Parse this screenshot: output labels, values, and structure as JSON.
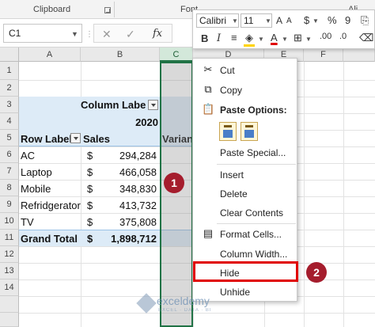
{
  "ribbon": {
    "clipboard_label": "Clipboard",
    "font_label": "Font",
    "alignment_label": "Ali"
  },
  "formula_bar": {
    "name_box": "C1",
    "cancel_glyph": "✕",
    "enter_glyph": "✓",
    "fx_label": "fx"
  },
  "columns": [
    "A",
    "B",
    "C",
    "D",
    "E",
    "F"
  ],
  "rows": [
    "1",
    "2",
    "3",
    "4",
    "5",
    "6",
    "7",
    "8",
    "9",
    "10",
    "11",
    "12",
    "13",
    "14"
  ],
  "pivot": {
    "column_labels": "Column Labels",
    "year": "2020",
    "row_labels": "Row Labels",
    "sales_header": "Sales",
    "variance_header": "Varian",
    "currency": "$",
    "items": [
      {
        "label": "AC",
        "value": "294,284"
      },
      {
        "label": "Laptop",
        "value": "466,058"
      },
      {
        "label": "Mobile",
        "value": "348,830"
      },
      {
        "label": "Refridgerator",
        "value": "413,732"
      },
      {
        "label": "TV",
        "value": "375,808"
      }
    ],
    "grand_total_label": "Grand Total",
    "grand_total_value": "1,898,712"
  },
  "mini_toolbar": {
    "font_name": "Calibri",
    "font_size": "11",
    "bold_glyph": "B",
    "italic_glyph": "I",
    "currency_glyph": "$",
    "percent_glyph": "%",
    "comma_glyph": "9",
    "font_color_glyph": "A",
    "font_color": "#e00000",
    "fill_color": "#ffd400"
  },
  "context_menu": {
    "cut": "Cut",
    "copy": "Copy",
    "paste_options": "Paste Options:",
    "paste_special": "Paste Special...",
    "insert": "Insert",
    "delete": "Delete",
    "clear_contents": "Clear Contents",
    "format_cells": "Format Cells...",
    "column_width": "Column Width...",
    "hide": "Hide",
    "unhide": "Unhide"
  },
  "annotations": {
    "step1": "1",
    "step2": "2",
    "highlight_color": "#e00000",
    "badge_color": "#a51d2d"
  },
  "watermark": {
    "brand": "exceldemy",
    "tagline": "EXCEL · DATA · BI"
  },
  "colors": {
    "accent": "#217346",
    "pivot_band": "#ddebf7"
  }
}
